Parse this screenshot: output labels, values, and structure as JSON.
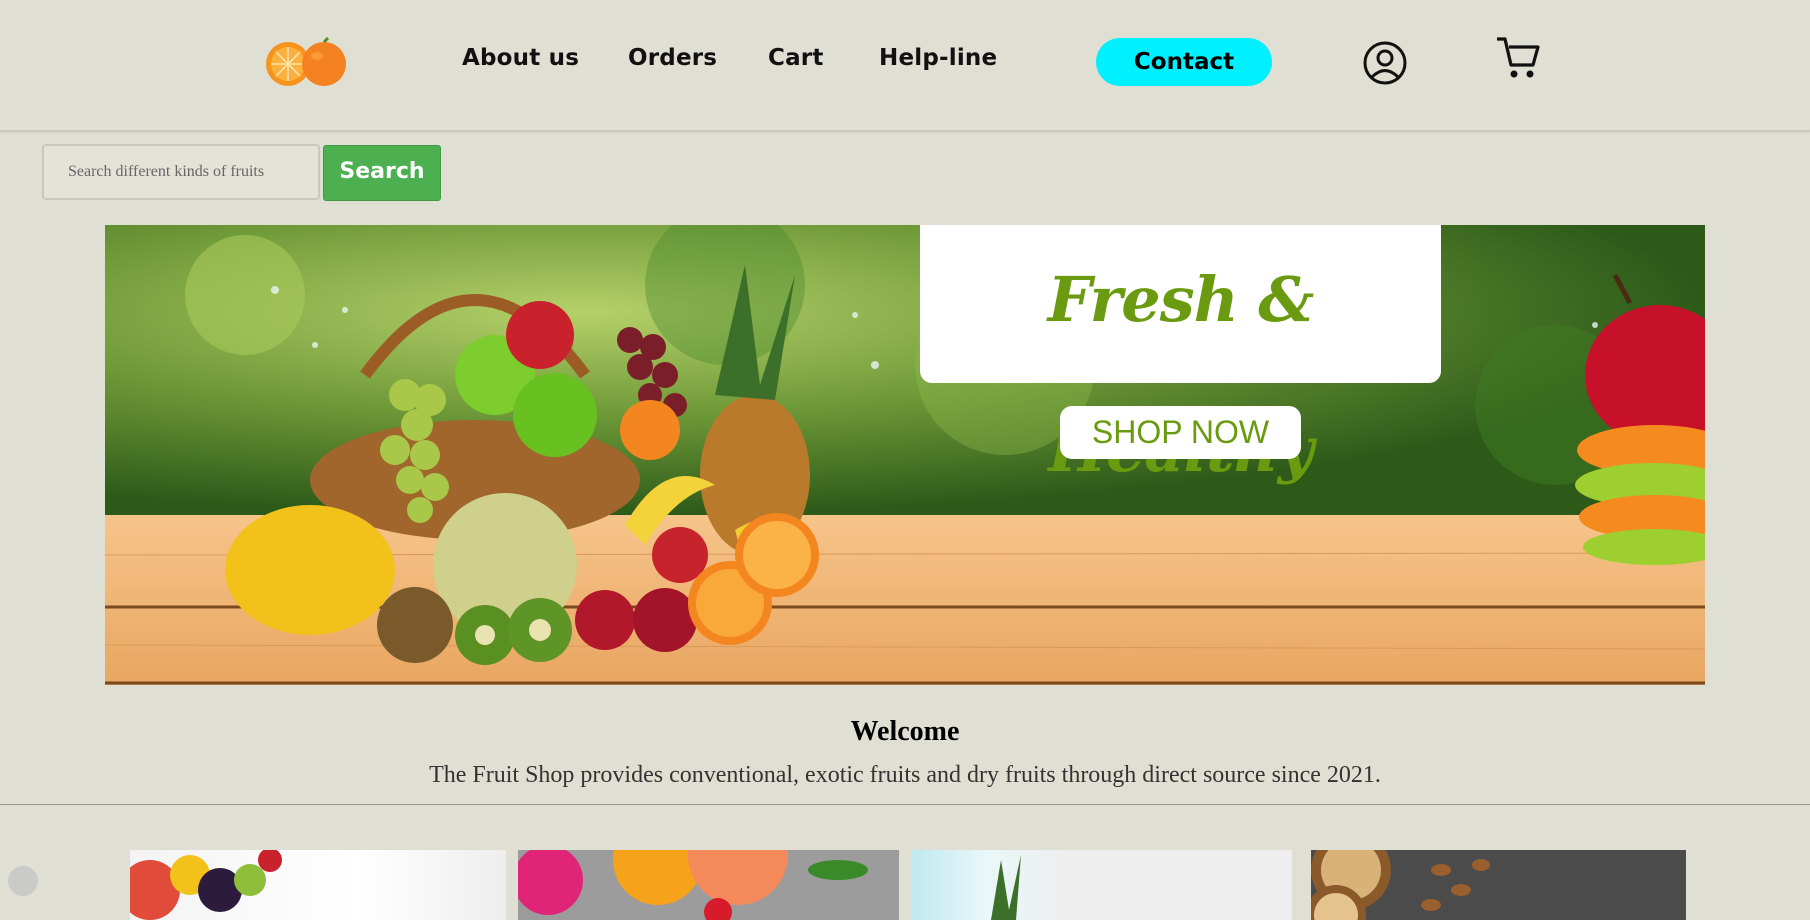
{
  "header": {
    "nav": [
      "About us",
      "Orders",
      "Cart",
      "Help-line"
    ],
    "contact_label": "Contact",
    "icons": {
      "logo": "orange-logo-icon",
      "user": "user-circle-icon",
      "cart": "shopping-cart-icon"
    },
    "accent_color": "#00f0ff"
  },
  "search": {
    "placeholder": "Search different kinds of fruits",
    "button_label": "Search",
    "button_color": "#4caf50"
  },
  "banner": {
    "headline": "Fresh & Healthy",
    "cta_label": "SHOP NOW",
    "text_color": "#6a9a0f"
  },
  "welcome": {
    "title": "Welcome",
    "text": "The Fruit Shop provides conventional, exotic fruits and dry fruits through direct source since 2021."
  }
}
